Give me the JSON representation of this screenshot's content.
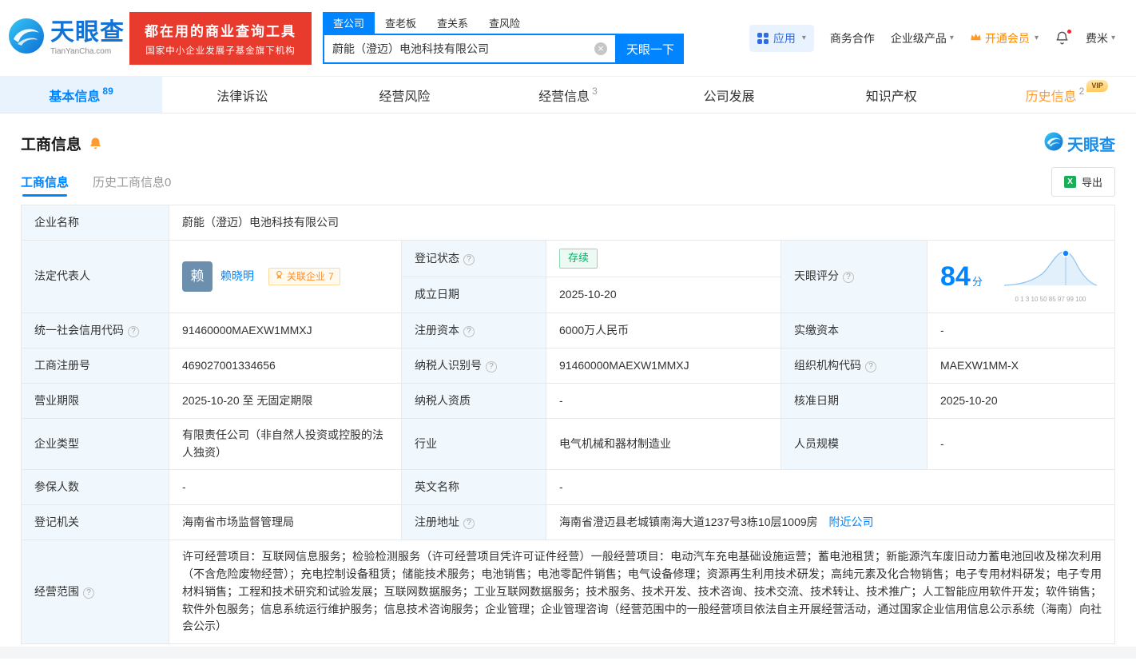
{
  "colors": {
    "brand_blue": "#0084ff",
    "logo_blue": "#1373d5",
    "promo_red": "#e93a2e",
    "status_green": "#00b365",
    "history_orange": "#ff9a2e",
    "vip_gold": "#ffc95e",
    "label_cell_bg": "#f1f8fd"
  },
  "icons": {
    "caret_down": "▾",
    "clear": "×",
    "help": "?",
    "excel": "X"
  },
  "header": {
    "logo": {
      "name": "天眼查",
      "domain": "TianYanCha.com"
    },
    "promo": {
      "line1": "都在用的商业查询工具",
      "line2": "国家中小企业发展子基金旗下机构"
    },
    "search": {
      "tabs": [
        {
          "label": "查公司"
        },
        {
          "label": "查老板"
        },
        {
          "label": "查关系"
        },
        {
          "label": "查风险"
        }
      ],
      "value": "蔚能（澄迈）电池科技有限公司",
      "button": "天眼一下"
    },
    "right": {
      "apps": "应用",
      "cooperation": "商务合作",
      "enterprise": "企业级产品",
      "vip": "开通会员",
      "user": "费米"
    }
  },
  "nav_tabs": [
    {
      "label": "基本信息",
      "count": "89"
    },
    {
      "label": "法律诉讼",
      "count": ""
    },
    {
      "label": "经营风险",
      "count": ""
    },
    {
      "label": "经营信息",
      "count": "3"
    },
    {
      "label": "公司发展",
      "count": ""
    },
    {
      "label": "知识产权",
      "count": ""
    },
    {
      "label": "历史信息",
      "count": "2",
      "badge": "VIP"
    }
  ],
  "section": {
    "title": "工商信息",
    "watermark": "天眼查",
    "subtabs": [
      {
        "label": "工商信息"
      },
      {
        "label": "历史工商信息0"
      }
    ],
    "export_label": "导出"
  },
  "table": {
    "company_name": {
      "label": "企业名称",
      "value": "蔚能（澄迈）电池科技有限公司"
    },
    "legal_rep": {
      "label": "法定代表人",
      "avatar": "赖",
      "name": "赖晓明",
      "related_label": "关联企业",
      "related_count": "7"
    },
    "reg_status": {
      "label": "登记状态",
      "value": "存续"
    },
    "score": {
      "label": "天眼评分",
      "value": "84",
      "unit": "分",
      "axis": "0 1 3 10 50 85 97 99 100"
    },
    "establish_date": {
      "label": "成立日期",
      "value": "2025-10-20"
    },
    "credit_code": {
      "label": "统一社会信用代码",
      "value": "91460000MAEXW1MMXJ"
    },
    "reg_capital": {
      "label": "注册资本",
      "value": "6000万人民币"
    },
    "paid_capital": {
      "label": "实缴资本",
      "value": "-"
    },
    "reg_number": {
      "label": "工商注册号",
      "value": "469027001334656"
    },
    "taxpayer_id": {
      "label": "纳税人识别号",
      "value": "91460000MAEXW1MMXJ"
    },
    "org_code": {
      "label": "组织机构代码",
      "value": "MAEXW1MM-X"
    },
    "business_term": {
      "label": "营业期限",
      "value": "2025-10-20 至 无固定期限"
    },
    "taxpayer_quality": {
      "label": "纳税人资质",
      "value": "-"
    },
    "approval_date": {
      "label": "核准日期",
      "value": "2025-10-20"
    },
    "company_type": {
      "label": "企业类型",
      "value": "有限责任公司（非自然人投资或控股的法人独资）"
    },
    "industry": {
      "label": "行业",
      "value": "电气机械和器材制造业"
    },
    "staff_size": {
      "label": "人员规模",
      "value": "-"
    },
    "insured_num": {
      "label": "参保人数",
      "value": "-"
    },
    "english_name": {
      "label": "英文名称",
      "value": "-"
    },
    "reg_authority": {
      "label": "登记机关",
      "value": "海南省市场监督管理局"
    },
    "reg_address": {
      "label": "注册地址",
      "value": "海南省澄迈县老城镇南海大道1237号3栋10层1009房",
      "nearby": "附近公司"
    },
    "business_scope": {
      "label": "经营范围",
      "value": "许可经营项目：互联网信息服务；检验检测服务（许可经营项目凭许可证件经营）一般经营项目：电动汽车充电基础设施运营；蓄电池租赁；新能源汽车废旧动力蓄电池回收及梯次利用（不含危险废物经营）；充电控制设备租赁；储能技术服务；电池销售；电池零配件销售；电气设备修理；资源再生利用技术研发；高纯元素及化合物销售；电子专用材料研发；电子专用材料销售；工程和技术研究和试验发展；互联网数据服务；工业互联网数据服务；技术服务、技术开发、技术咨询、技术交流、技术转让、技术推广；人工智能应用软件开发；软件销售；软件外包服务；信息系统运行维护服务；信息技术咨询服务；企业管理；企业管理咨询（经营范围中的一般经营项目依法自主开展经营活动，通过国家企业信用信息公示系统（海南）向社会公示）"
    }
  }
}
